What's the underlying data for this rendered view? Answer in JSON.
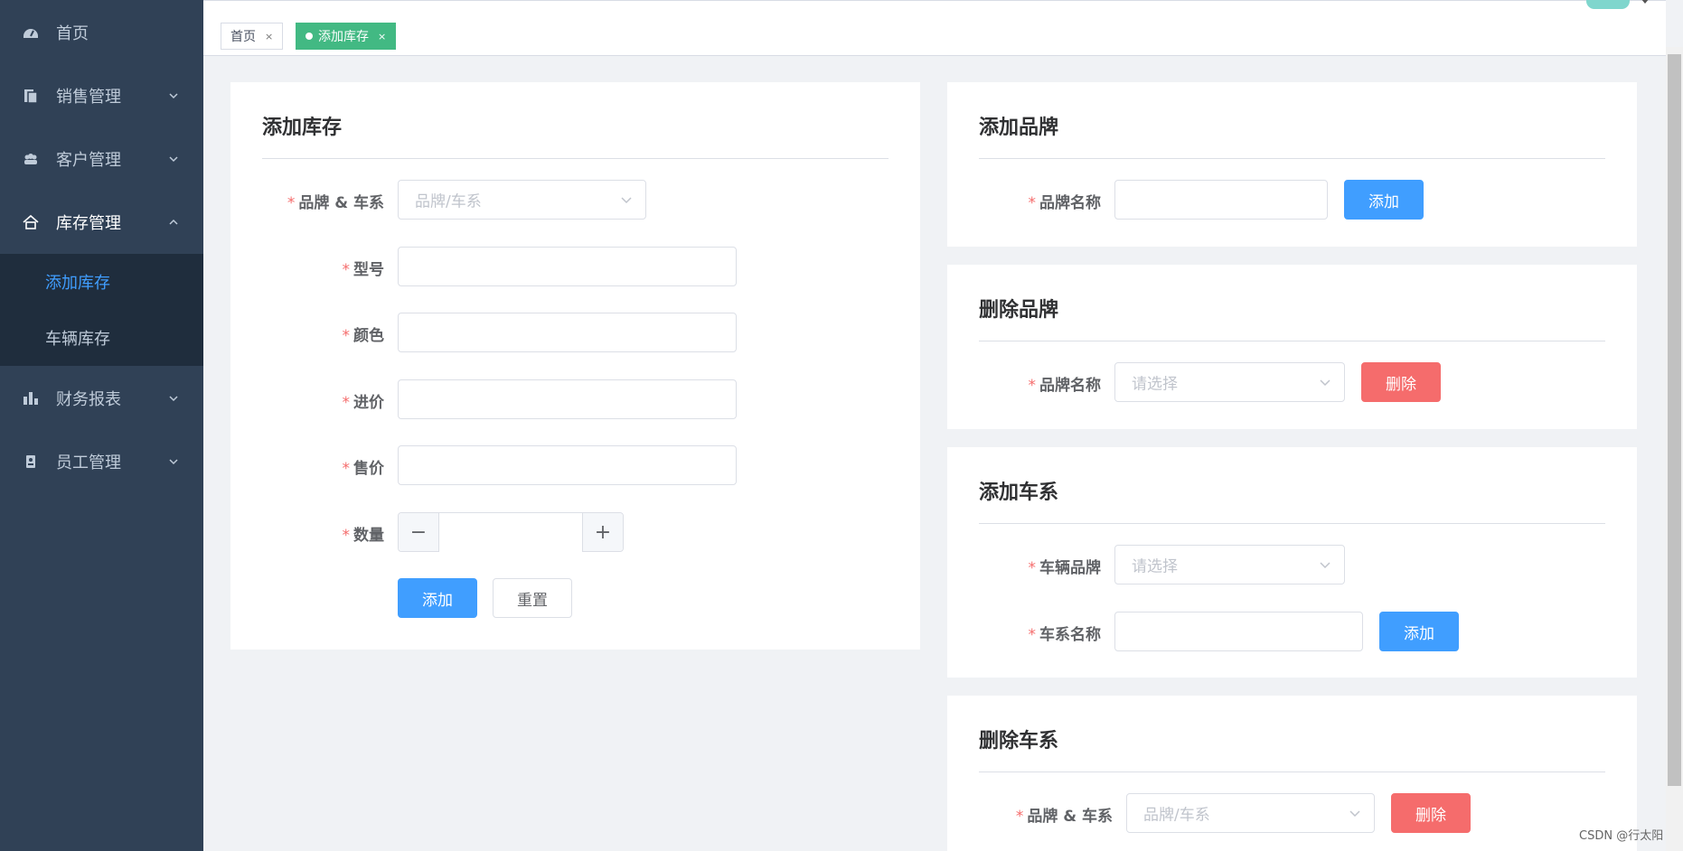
{
  "sidebar": {
    "items": [
      {
        "label": "首页",
        "icon": "dashboard-icon"
      },
      {
        "label": "销售管理",
        "icon": "document-icon"
      },
      {
        "label": "客户管理",
        "icon": "people-icon"
      },
      {
        "label": "库存管理",
        "icon": "home-icon"
      },
      {
        "label": "财务报表",
        "icon": "bar-chart-icon"
      },
      {
        "label": "员工管理",
        "icon": "badge-icon"
      }
    ],
    "submenu": [
      {
        "label": "添加库存",
        "active": true
      },
      {
        "label": "车辆库存",
        "active": false
      }
    ]
  },
  "tags": [
    {
      "label": "首页",
      "active": false,
      "close": "×"
    },
    {
      "label": "添加库存",
      "active": true,
      "close": "×"
    }
  ],
  "add_stock": {
    "title": "添加库存",
    "fields": {
      "brand_series": {
        "label": "品牌 & 车系",
        "placeholder": "品牌/车系"
      },
      "model": {
        "label": "型号",
        "value": ""
      },
      "color": {
        "label": "颜色",
        "value": ""
      },
      "purchase_price": {
        "label": "进价",
        "value": ""
      },
      "sale_price": {
        "label": "售价",
        "value": ""
      },
      "quantity": {
        "label": "数量",
        "value": "",
        "minus": "−",
        "plus": "+"
      }
    },
    "add_label": "添加",
    "reset_label": "重置"
  },
  "add_brand": {
    "title": "添加品牌",
    "field_label": "品牌名称",
    "value": "",
    "button": "添加"
  },
  "delete_brand": {
    "title": "删除品牌",
    "field_label": "品牌名称",
    "placeholder": "请选择",
    "button": "删除"
  },
  "add_series": {
    "title": "添加车系",
    "brand_label": "车辆品牌",
    "brand_placeholder": "请选择",
    "series_label": "车系名称",
    "series_value": "",
    "button": "添加"
  },
  "delete_series": {
    "title": "删除车系",
    "field_label": "品牌 & 车系",
    "placeholder": "品牌/车系",
    "button": "删除"
  },
  "watermark": "CSDN @行太阳",
  "colors": {
    "sidebar": "#304156",
    "submenu": "#1f2d3d",
    "primary": "#409eff",
    "danger": "#f56c6c",
    "tag_active": "#42b983"
  }
}
